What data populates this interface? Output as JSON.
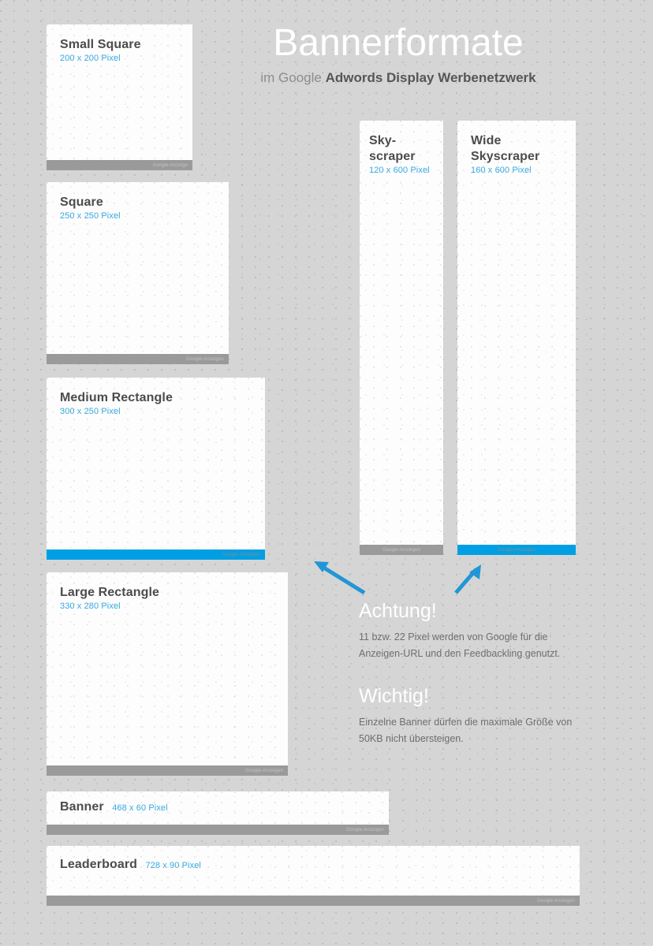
{
  "header": {
    "title": "Bannerformate",
    "subtitle_light": "im Google",
    "subtitle_dark": "Adwords Display Werbenetzwerk"
  },
  "colors": {
    "background": "#d5d5d5",
    "banner_fill": "#fdfdfd",
    "footer_gray": "#9a9a9a",
    "footer_blue": "#009fe3",
    "accent_blue": "#36a9e1",
    "title_gray": "#4c4c4c",
    "body_gray": "#6e6e6e"
  },
  "banners": [
    {
      "name": "Small Square",
      "dimensions": "200 x 200 Pixel",
      "footer_label": "Google-Anzeige",
      "footer_color": "gray",
      "footer_align": "right"
    },
    {
      "name": "Square",
      "dimensions": "250 x 250 Pixel",
      "footer_label": "Google-Anzeigen",
      "footer_color": "gray",
      "footer_align": "right"
    },
    {
      "name": "Medium Rectangle",
      "dimensions": "300 x 250 Pixel",
      "footer_label": "Google-Anzeigen",
      "footer_color": "blue",
      "footer_align": "right"
    },
    {
      "name": "Large Rectangle",
      "dimensions": "330 x 280 Pixel",
      "footer_label": "Google-Anzeigen",
      "footer_color": "gray",
      "footer_align": "right"
    },
    {
      "name": "Banner",
      "dimensions": "468 x 60 Pixel",
      "footer_label": "Google-Anzeigen",
      "footer_color": "gray",
      "footer_align": "right"
    },
    {
      "name": "Leaderboard",
      "dimensions": "728 x 90 Pixel",
      "footer_label": "Google-Anzeigen",
      "footer_color": "gray",
      "footer_align": "right"
    },
    {
      "name": "Sky-\nscraper",
      "name_line1": "Sky-",
      "name_line2": "scraper",
      "dimensions": "120 x 600 Pixel",
      "footer_label": "Google-Anzeigen",
      "footer_color": "gray",
      "footer_align": "center"
    },
    {
      "name": "Wide Skyscraper",
      "name_line1": "Wide",
      "name_line2": "Skyscraper",
      "dimensions": "160 x 600 Pixel",
      "footer_label": "Google-Anzeigen",
      "footer_color": "blue",
      "footer_align": "center"
    }
  ],
  "notes": [
    {
      "heading": "Achtung!",
      "body": "11 bzw. 22 Pixel werden von Google für die Anzeigen-URL und den Feedbackling genutzt."
    },
    {
      "heading": "Wichtig!",
      "body": "Einzelne Banner dürfen die maximale Größe von 50KB nicht übersteigen."
    }
  ]
}
